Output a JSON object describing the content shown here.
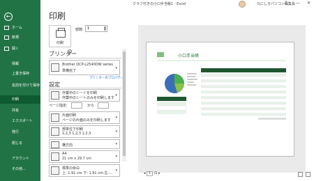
{
  "window": {
    "title": "クラフ付きの小口手当帳1 - Excel",
    "user": "なにしろパソコン編集長",
    "minimize": "—",
    "help": "?",
    "close": "✕"
  },
  "nav": {
    "back": "←",
    "items": [
      "ホーム",
      "新規",
      "開く",
      "情報",
      "上書き保存",
      "名前を付けて保存",
      "印刷",
      "共有",
      "エクスポート",
      "発行",
      "閉じる"
    ],
    "bottom": [
      "アカウント",
      "その他..."
    ]
  },
  "print": {
    "title": "印刷",
    "button": "印刷",
    "copies_label": "部数:",
    "copies_value": "1",
    "printer_section": "プリンター",
    "printer_name": "Brother DCP-L2540DW series",
    "printer_status": "準備完了",
    "printer_props": "プリンターのプロパティ",
    "settings_section": "設定",
    "pages_label": "ページ指定:",
    "pages_to": "から",
    "opt1_a": "作業中のシートを印刷",
    "opt1_b": "作業中のシートのみを印刷します",
    "opt2_a": "片面印刷",
    "opt2_b": "ページの片面のみを印刷します",
    "opt3_a": "部単位で印刷",
    "opt3_b": "1,2,3    1,2,3    1,2,3",
    "opt4_a": "横方向",
    "opt5_a": "A4",
    "opt5_b": "21 cm x 29.7 cm",
    "opt6_a": "標準の余白",
    "opt6_b": "上: 1.91 cm 下: 1.91 cm 左:..."
  },
  "preview": {
    "sheet_title": "小口手当帳",
    "page_current": "1",
    "page_total": "/1"
  }
}
